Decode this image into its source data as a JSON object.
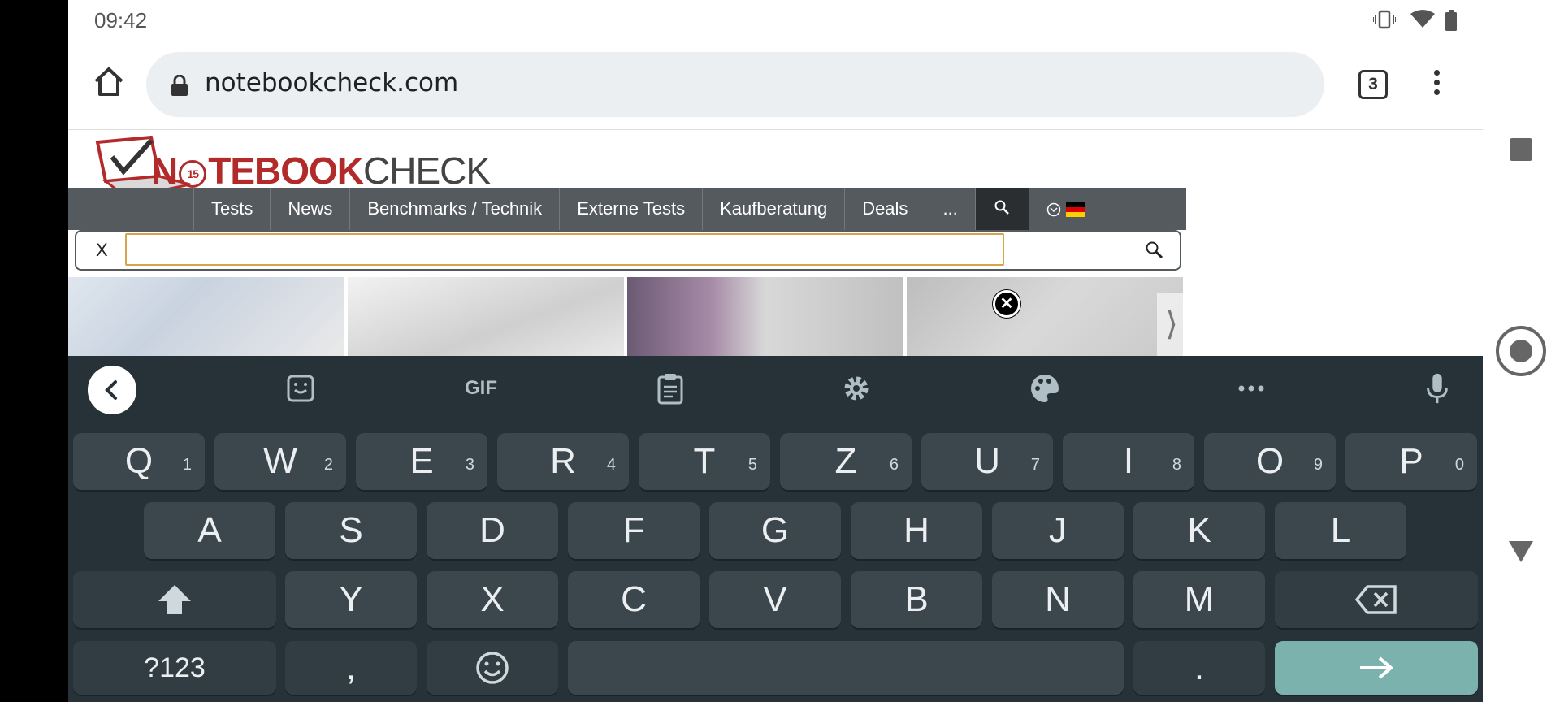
{
  "status": {
    "time": "09:42"
  },
  "browser": {
    "url": "notebookcheck.com",
    "tab_count": "3"
  },
  "site": {
    "logo_prefix": "N",
    "logo_badge": "15",
    "logo_red": "TEBOOK",
    "logo_grey": "CHECK",
    "nav": [
      "Tests",
      "News",
      "Benchmarks / Technik",
      "Externe Tests",
      "Kaufberatung",
      "Deals",
      "..."
    ],
    "search_close": "X",
    "search_value": ""
  },
  "keyboard": {
    "row1": [
      {
        "k": "Q",
        "h": "1"
      },
      {
        "k": "W",
        "h": "2"
      },
      {
        "k": "E",
        "h": "3"
      },
      {
        "k": "R",
        "h": "4"
      },
      {
        "k": "T",
        "h": "5"
      },
      {
        "k": "Z",
        "h": "6"
      },
      {
        "k": "U",
        "h": "7"
      },
      {
        "k": "I",
        "h": "8"
      },
      {
        "k": "O",
        "h": "9"
      },
      {
        "k": "P",
        "h": "0"
      }
    ],
    "row2": [
      "A",
      "S",
      "D",
      "F",
      "G",
      "H",
      "J",
      "K",
      "L"
    ],
    "row3": [
      "Y",
      "X",
      "C",
      "V",
      "B",
      "N",
      "M"
    ],
    "symbols_label": "?123",
    "comma": ",",
    "period": ".",
    "gif_label": "GIF"
  },
  "colors": {
    "keyboard_bg": "#263238",
    "key_bg": "#3c474d",
    "enter_bg": "#7cb2ae",
    "brand_red": "#b22a2a"
  }
}
